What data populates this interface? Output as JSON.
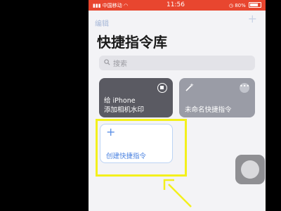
{
  "status_bar": {
    "carrier": "中国移动",
    "time": "11:56",
    "battery": "80%",
    "battery_level": 0.8
  },
  "header": {
    "edit_label": "编辑",
    "add_icon": "plus-icon",
    "title": "快捷指令库"
  },
  "search": {
    "placeholder": "搜索"
  },
  "shortcuts": [
    {
      "title_line1": "给 iPhone",
      "title_line2": "添加相机水印",
      "color": "#5a5a62",
      "icon": "stop-icon"
    },
    {
      "title_line1": "未命名快捷指令",
      "color": "#9a9ca6",
      "icon": "magic-wand-icon"
    }
  ],
  "create": {
    "label": "创建快捷指令"
  },
  "colors": {
    "status_bar": "#e8462f",
    "highlight": "#f3f01c",
    "accent": "#4a82e0"
  }
}
